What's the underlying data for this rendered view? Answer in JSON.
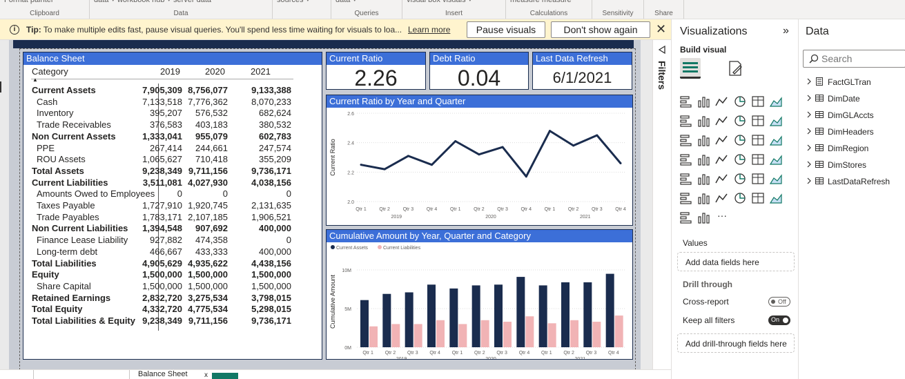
{
  "ribbon": {
    "groups": [
      {
        "cut": "Format painter",
        "label": "Clipboard"
      },
      {
        "cut": "data ˅   workbook   hub ˅   server   data",
        "label": "Data"
      },
      {
        "cut": "sources ˅",
        "label": ""
      },
      {
        "cut": "data ˅",
        "label": "Queries"
      },
      {
        "cut": "visual   box   visuals ˅",
        "label": "Insert"
      },
      {
        "cut": "measure  measure",
        "label": "Calculations"
      },
      {
        "cut": "",
        "label": "Sensitivity"
      },
      {
        "cut": "",
        "label": "Share"
      }
    ]
  },
  "tip": {
    "label": "Tip:",
    "text": " To make multiple edits fast, pause visual queries. You'll spend less time waiting for visuals to loa...",
    "learn_more": "Learn more",
    "pause": "Pause visuals",
    "dont_show": "Don't show again",
    "close": "✕"
  },
  "balance_sheet": {
    "title": "Balance Sheet",
    "headers": [
      "Category",
      "2019",
      "2020",
      "2021"
    ],
    "rows": [
      {
        "cat": "Current Assets",
        "v": [
          "7,905,309",
          "8,756,077",
          "9,133,388"
        ],
        "bold": true
      },
      {
        "cat": "Cash",
        "v": [
          "7,133,518",
          "7,776,362",
          "8,070,233"
        ],
        "bold": false
      },
      {
        "cat": "Inventory",
        "v": [
          "395,207",
          "576,532",
          "682,624"
        ],
        "bold": false
      },
      {
        "cat": "Trade Receivables",
        "v": [
          "376,583",
          "403,183",
          "380,532"
        ],
        "bold": false
      },
      {
        "cat": "Non Current Assets",
        "v": [
          "1,333,041",
          "955,079",
          "602,783"
        ],
        "bold": true
      },
      {
        "cat": "PPE",
        "v": [
          "267,414",
          "244,661",
          "247,574"
        ],
        "bold": false
      },
      {
        "cat": "ROU Assets",
        "v": [
          "1,065,627",
          "710,418",
          "355,209"
        ],
        "bold": false
      },
      {
        "cat": "Total Assets",
        "v": [
          "9,238,349",
          "9,711,156",
          "9,736,171"
        ],
        "bold": true
      },
      {
        "cat": "Current Liabilities",
        "v": [
          "3,511,081",
          "4,027,930",
          "4,038,156"
        ],
        "bold": true
      },
      {
        "cat": "Amounts Owed to Employees",
        "v": [
          "0",
          "0",
          "0"
        ],
        "bold": false
      },
      {
        "cat": "Taxes Payable",
        "v": [
          "1,727,910",
          "1,920,745",
          "2,131,635"
        ],
        "bold": false
      },
      {
        "cat": "Trade Payables",
        "v": [
          "1,783,171",
          "2,107,185",
          "1,906,521"
        ],
        "bold": false
      },
      {
        "cat": "Non Current Liabilities",
        "v": [
          "1,394,548",
          "907,692",
          "400,000"
        ],
        "bold": true
      },
      {
        "cat": "Finance Lease Liability",
        "v": [
          "927,882",
          "474,358",
          "0"
        ],
        "bold": false
      },
      {
        "cat": "Long-term debt",
        "v": [
          "466,667",
          "433,333",
          "400,000"
        ],
        "bold": false
      },
      {
        "cat": "Total Liabilities",
        "v": [
          "4,905,629",
          "4,935,622",
          "4,438,156"
        ],
        "bold": true
      },
      {
        "cat": "Equity",
        "v": [
          "1,500,000",
          "1,500,000",
          "1,500,000"
        ],
        "bold": true
      },
      {
        "cat": "Share Capital",
        "v": [
          "1,500,000",
          "1,500,000",
          "1,500,000"
        ],
        "bold": false
      },
      {
        "cat": "Retained Earnings",
        "v": [
          "2,832,720",
          "3,275,534",
          "3,798,015"
        ],
        "bold": true
      },
      {
        "cat": "Total Equity",
        "v": [
          "4,332,720",
          "4,775,534",
          "5,298,015"
        ],
        "bold": true
      },
      {
        "cat": "Total Liabilities & Equity",
        "v": [
          "9,238,349",
          "9,711,156",
          "9,736,171"
        ],
        "bold": true
      }
    ]
  },
  "kpis": {
    "current_ratio": {
      "title": "Current Ratio",
      "value": "2.26"
    },
    "debt_ratio": {
      "title": "Debt Ratio",
      "value": "0.04"
    },
    "last_refresh": {
      "title": "Last Data Refresh",
      "value": "6/1/2021"
    }
  },
  "chart_data": [
    {
      "type": "line",
      "title": "Current Ratio by Year and Quarter",
      "ylabel": "Current Ratio",
      "xlabel": "",
      "ylim": [
        2.0,
        2.6
      ],
      "yticks": [
        "2.0",
        "2.2",
        "2.4",
        "2.6"
      ],
      "years": [
        "2019",
        "2020",
        "2021"
      ],
      "categories": [
        "Qtr 1",
        "Qtr 2",
        "Qtr 3",
        "Qtr 4",
        "Qtr 1",
        "Qtr 2",
        "Qtr 3",
        "Qtr 4",
        "Qtr 1",
        "Qtr 2",
        "Qtr 3",
        "Qtr 4"
      ],
      "values": [
        2.25,
        2.22,
        2.31,
        2.25,
        2.41,
        2.32,
        2.37,
        2.17,
        2.48,
        2.38,
        2.45,
        2.26
      ],
      "grid": true,
      "color": "#1a2c4e"
    },
    {
      "type": "bar",
      "title": "Cumulative Amount by Year, Quarter and Category",
      "ylabel": "Cumulative Amount",
      "xlabel": "",
      "ylim": [
        0,
        10
      ],
      "yticks": [
        "0M",
        "5M",
        "10M"
      ],
      "years": [
        "2019",
        "2020",
        "2021"
      ],
      "categories": [
        "Qtr 1",
        "Qtr 2",
        "Qtr 3",
        "Qtr 4",
        "Qtr 1",
        "Qtr 2",
        "Qtr 3",
        "Qtr 4",
        "Qtr 1",
        "Qtr 2",
        "Qtr 3",
        "Qtr 4"
      ],
      "legend": "top-left",
      "grid": true,
      "series": [
        {
          "name": "Current Assets",
          "color": "#1a2c4e",
          "values": [
            6.1,
            6.9,
            7.1,
            8.1,
            7.6,
            8.0,
            8.1,
            9.1,
            8.0,
            8.4,
            8.4,
            9.5
          ]
        },
        {
          "name": "Current Liabilities",
          "color": "#f1b3b5",
          "values": [
            2.7,
            3.0,
            3.0,
            3.5,
            3.0,
            3.5,
            3.3,
            4.0,
            3.1,
            3.5,
            3.3,
            4.1
          ]
        }
      ]
    }
  ],
  "bottom_tabs": {
    "tab1": "",
    "tab2": "Balance Sheet",
    "close": "x"
  },
  "filters": {
    "label": "Filters"
  },
  "visualizations": {
    "title": "Visualizations",
    "collapse": "»",
    "build_label": "Build visual",
    "values_label": "Values",
    "values_well": "Add data fields here",
    "drill_label": "Drill through",
    "cross_report": "Cross-report",
    "cross_report_state": "Off",
    "keep_filters": "Keep all filters",
    "keep_filters_state": "On",
    "drill_well": "Add drill-through fields here",
    "more": "···"
  },
  "data_pane": {
    "title": "Data",
    "search_placeholder": "Search",
    "tables": [
      "FactGLTran",
      "DimDate",
      "DimGLAccts",
      "DimHeaders",
      "DimRegion",
      "DimStores",
      "LastDataRefresh"
    ]
  },
  "colors": {
    "accent": "#3c6fd8",
    "navy": "#1a2c4e",
    "pink": "#f1b3b5"
  }
}
